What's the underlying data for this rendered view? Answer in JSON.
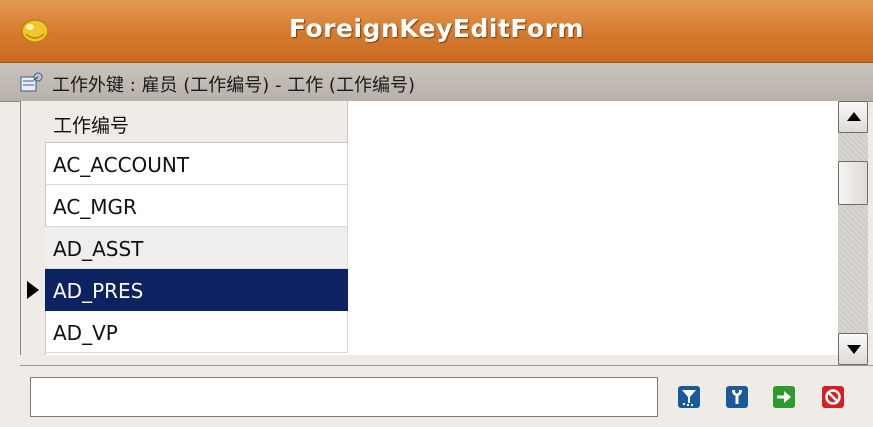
{
  "window": {
    "title": "ForeignKeyEditForm"
  },
  "header": {
    "text": "工作外键 : 雇员 (工作编号) - 工作 (工作编号)"
  },
  "grid": {
    "column_header": "工作编号",
    "rows": [
      "AC_ACCOUNT",
      "AC_MGR",
      "AD_ASST",
      "AD_PRES",
      "AD_VP"
    ],
    "selected_row": "AD_PRES"
  },
  "filter": {
    "value": "",
    "placeholder": ""
  },
  "toolbar": {
    "buttons": [
      "filter-icon",
      "key-icon",
      "confirm-arrow-icon",
      "cancel-icon"
    ]
  },
  "colors": {
    "title_bar": "#d47a2e",
    "selection": "#0c2261",
    "filter_button": "#1a5a9a",
    "key_button": "#1a5a9a",
    "confirm_button": "#2e9a2e",
    "cancel_button": "#d42020"
  }
}
